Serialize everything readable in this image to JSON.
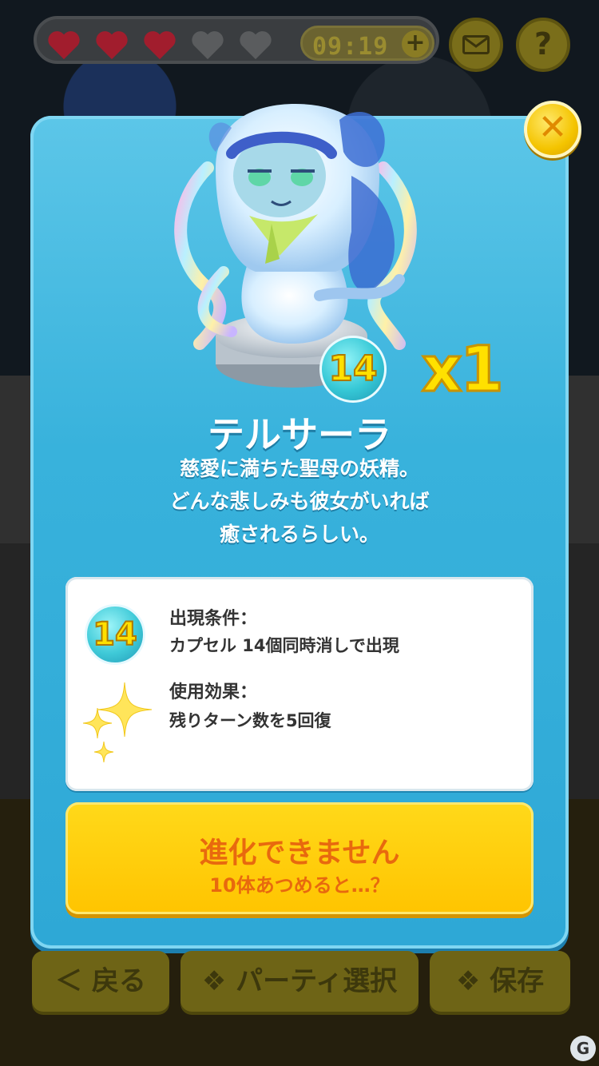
{
  "hud": {
    "hearts": [
      "full",
      "full",
      "full",
      "empty",
      "empty"
    ],
    "timer": "09:19",
    "timer_plus_label": "+",
    "mail_icon": "envelope-icon",
    "help_label": "?"
  },
  "modal": {
    "close_label": "✕",
    "character": {
      "name": "テルサーラ",
      "capsule_count": "14",
      "quantity": "x1",
      "description": [
        "慈愛に満ちた聖母の妖精。",
        "どんな悲しみも彼女がいれば",
        "癒されるらしい。"
      ]
    },
    "info": {
      "badge": "14",
      "condition_label": "出現条件：",
      "condition_value": "カプセル 14個同時消しで出現",
      "effect_label": "使用効果：",
      "effect_value": "残りターン数を5回復"
    },
    "evolve": {
      "main": "進化できません",
      "sub": "10体あつめると…？"
    }
  },
  "nav": {
    "back": "＜ 戻る",
    "party": "❖ パーティ選択",
    "save": "❖ 保存"
  },
  "colors": {
    "modal_bg": "#38b2dc",
    "button_yellow": "#ffc400",
    "button_text": "#e8690e"
  }
}
